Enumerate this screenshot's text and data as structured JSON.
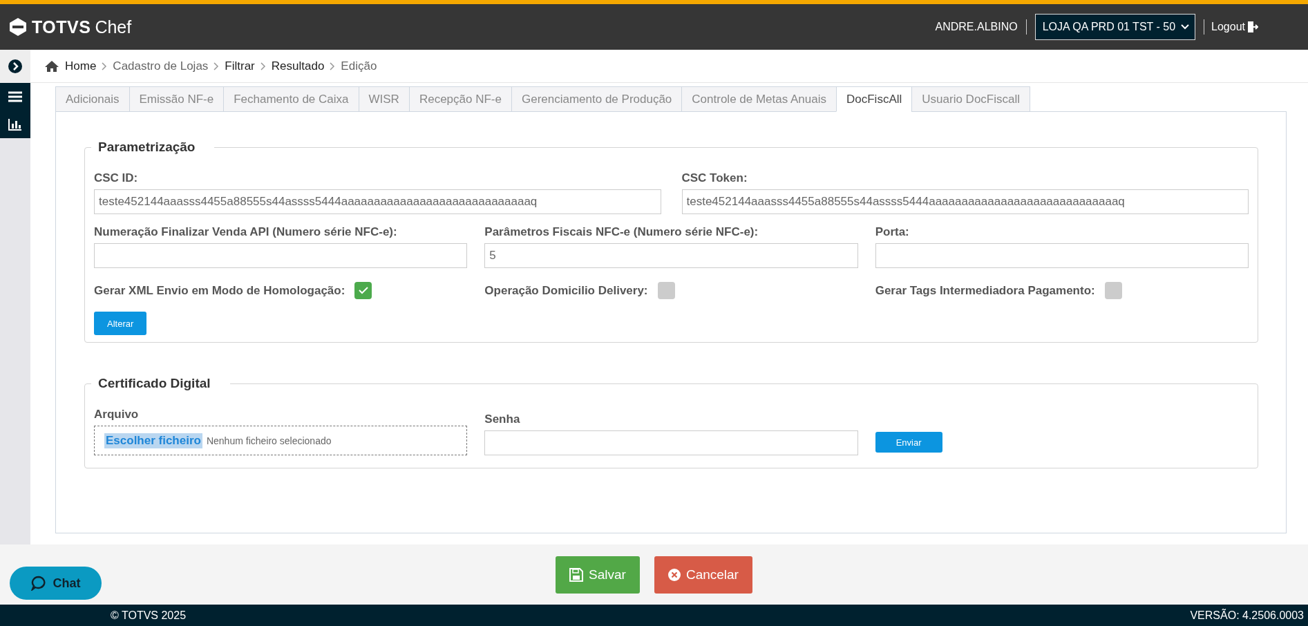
{
  "header": {
    "brand": "TOTVS",
    "product": "Chef",
    "user": "ANDRE.ALBINO",
    "store_select": {
      "value": "LOJA QA PRD 01 TST - 50"
    },
    "logout": "Logout"
  },
  "breadcrumb": [
    {
      "label": "Home",
      "link": true
    },
    {
      "label": "Cadastro de Lojas",
      "link": false
    },
    {
      "label": "Filtrar",
      "link": true
    },
    {
      "label": "Resultado",
      "link": true
    },
    {
      "label": "Edição",
      "link": false
    }
  ],
  "tabs": [
    {
      "label": "Adicionais",
      "selected": false
    },
    {
      "label": "Emissão NF-e",
      "selected": false
    },
    {
      "label": "Fechamento de Caixa",
      "selected": false
    },
    {
      "label": "WISR",
      "selected": false
    },
    {
      "label": "Recepção NF-e",
      "selected": false
    },
    {
      "label": "Gerenciamento de Produção",
      "selected": false
    },
    {
      "label": "Controle de Metas Anuais",
      "selected": false
    },
    {
      "label": "DocFiscAll",
      "selected": true
    },
    {
      "label": "Usuario DocFiscall",
      "selected": false
    }
  ],
  "parametrizacao": {
    "title": "Parametrização",
    "text_fields": [
      {
        "label": "CSC ID:",
        "value": "teste452144aaasss4455a88555s44assss5444aaaaaaaaaaaaaaaaaaaaaaaaaaaaaq"
      },
      {
        "label": "CSC Token:",
        "value": "teste452144aaasss4455a88555s44assss5444aaaaaaaaaaaaaaaaaaaaaaaaaaaaaq"
      }
    ],
    "number_fields": [
      {
        "label": "Numeração Finalizar Venda API (Numero série NFC-e):"
      },
      {
        "label": "Parâmetros Fiscais NFC-e (Numero série NFC-e):",
        "value": "5"
      },
      {
        "label": "Porta:"
      }
    ],
    "checkboxes": [
      {
        "label": "Gerar XML Envio em Modo de Homologação:",
        "checked": true
      },
      {
        "label": "Operação Domicilio Delivery:",
        "checked": false
      },
      {
        "label": "Gerar Tags Intermediadora Pagamento:",
        "checked": false
      }
    ],
    "button": "Alterar"
  },
  "certificado": {
    "title": "Certificado Digital",
    "file_label": "Arquivo",
    "file_button": "Escolher ficheiro",
    "file_status": "Nenhum ficheiro selecionado",
    "password_label": "Senha",
    "button": "Enviar"
  },
  "actions": {
    "save": "Salvar",
    "cancel": "Cancelar"
  },
  "chat": "Chat",
  "footer": {
    "copyright": "© TOTVS 2025",
    "version": "VERSÃO: 4.2506.0003"
  }
}
